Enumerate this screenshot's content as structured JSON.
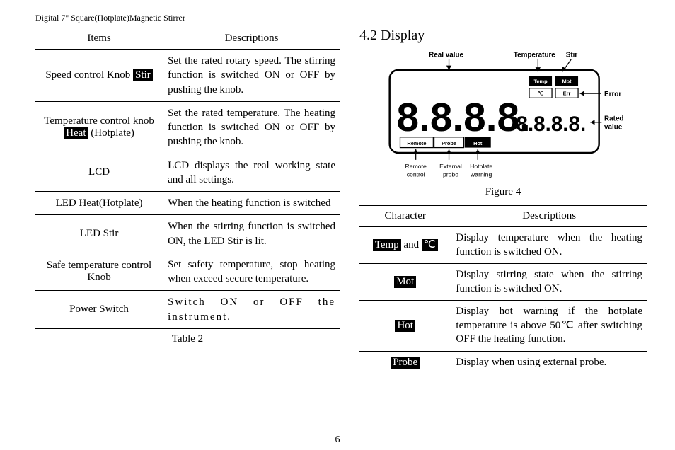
{
  "header": "Digital 7\" Square(Hotplate)Magnetic Stirrer",
  "page_number": "6",
  "section_title": "4.2 Display",
  "table2": {
    "caption": "Table 2",
    "head": {
      "items": "Items",
      "desc": "Descriptions"
    },
    "rows": [
      {
        "item_pre": "Speed control Knob ",
        "item_inv": "Stir",
        "item_post": "",
        "desc": "Set the rated rotary speed. The stirring function is switched ON or OFF by pushing the knob."
      },
      {
        "item_pre": "Temperature control knob ",
        "item_inv": "Heat",
        "item_post": " (Hotplate)",
        "desc": "Set the rated temperature. The heating function is switched ON or OFF by pushing the knob."
      },
      {
        "item_pre": "LCD",
        "item_inv": "",
        "item_post": "",
        "desc": "LCD displays the real working state and all settings."
      },
      {
        "item_pre": "LED Heat(Hotplate)",
        "item_inv": "",
        "item_post": "",
        "desc": "When the heating function is switched"
      },
      {
        "item_pre": "LED Stir",
        "item_inv": "",
        "item_post": "",
        "desc": "When the stirring function is switched ON, the LED Stir is lit."
      },
      {
        "item_pre": "Safe temperature control Knob",
        "item_inv": "",
        "item_post": "",
        "desc": "Set safety temperature, stop heating when exceed secure temperature."
      },
      {
        "item_pre": "Power Switch",
        "item_inv": "",
        "item_post": "",
        "desc": "Switch ON or OFF the instrument.",
        "wide": true
      }
    ]
  },
  "figure": {
    "caption": "Figure 4",
    "labels": {
      "real_value": "Real value",
      "temperature": "Temperature",
      "stir": "Stir",
      "error": "Error",
      "rated1": "Rated",
      "rated2": "value",
      "remote1": "Remote",
      "remote2": "control",
      "external1": "External",
      "external2": "probe",
      "hotplate1": "Hotplate",
      "hotplate2": "warning"
    },
    "indicators": {
      "temp": "Temp",
      "mot": "Mot",
      "c": "℃",
      "err": "Err",
      "remote": "Remote",
      "probe": "Probe",
      "hot": "Hot"
    },
    "big_digits": "8.8.8.8.",
    "small_digits": "8.8.8.8."
  },
  "table3": {
    "head": {
      "char": "Character",
      "desc": "Descriptions"
    },
    "rows": [
      {
        "char_inv1": "Temp",
        "char_mid": " and ",
        "char_inv2": "℃",
        "desc": "Display temperature when the heating function is switched ON."
      },
      {
        "char_inv1": "Mot",
        "char_mid": "",
        "char_inv2": "",
        "desc": "Display stirring state when the stirring function is switched ON."
      },
      {
        "char_inv1": "Hot",
        "char_mid": "",
        "char_inv2": "",
        "desc": "Display hot warning if the hotplate temperature is above 50℃ after switching OFF the heating function."
      },
      {
        "char_inv1": "Probe",
        "char_mid": "",
        "char_inv2": "",
        "desc": "Display when using external probe."
      }
    ]
  }
}
